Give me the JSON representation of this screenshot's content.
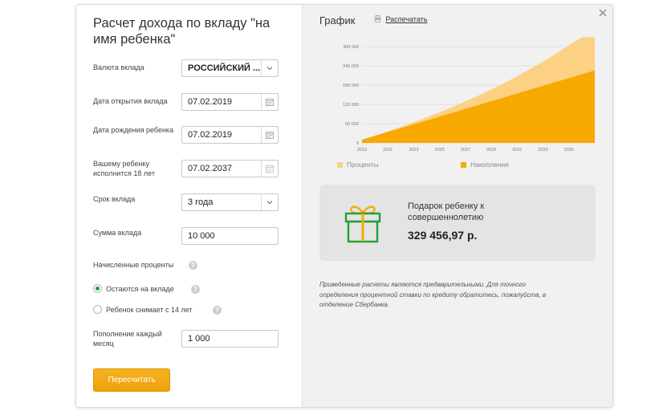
{
  "form": {
    "title": "Расчет дохода по вкладу \"на имя ребенка\"",
    "currency": {
      "label": "Валюта вклада",
      "value": "РОССИЙСКИЙ ..."
    },
    "open_date": {
      "label": "Дата открытия вклада",
      "value": "07.02.2019"
    },
    "birth_date": {
      "label": "Дата рождения ребенка",
      "value": "07.02.2019"
    },
    "age18_date": {
      "label": "Вашему ребенку исполнится 18 лет",
      "value": "07.02.2037"
    },
    "term": {
      "label": "Срок вклада",
      "value": "3 года"
    },
    "amount": {
      "label": "Сумма вклада",
      "value": "10 000"
    },
    "interest_label": "Начисленные проценты",
    "options": [
      {
        "label": "Остаются на вкладе",
        "selected": true
      },
      {
        "label": "Ребенок снимает с 14 лет",
        "selected": false
      }
    ],
    "topup": {
      "label": "Пополнение каждый месяц",
      "value": "1 000"
    },
    "recalc_button": "Пересчитать"
  },
  "graph": {
    "title": "График",
    "print_label": "Распечатать",
    "colors": {
      "interest": "#fcd183",
      "savings": "#f8a901",
      "gift_green": "#21a038",
      "gift_ribbon": "#f8a901",
      "accent": "#eda00b"
    }
  },
  "chart_data": {
    "type": "area",
    "x": [
      2019,
      2020,
      2021,
      2022,
      2023,
      2024,
      2025,
      2026,
      2027,
      2028,
      2029,
      2030,
      2031,
      2032,
      2033,
      2034,
      2035,
      2036,
      2037
    ],
    "x_ticks": [
      "2019",
      "2021",
      "2023",
      "2025",
      "2027",
      "2029",
      "2031",
      "2033",
      "2035"
    ],
    "y_ticks": [
      "0",
      "60 000",
      "120 000",
      "180 000",
      "240 000",
      "300 000"
    ],
    "ylim": [
      0,
      300000
    ],
    "series": [
      {
        "name": "Накопления",
        "values": [
          10000,
          22000,
          34000,
          46000,
          58000,
          70000,
          82000,
          94000,
          106000,
          118000,
          130000,
          142000,
          154000,
          166000,
          178000,
          190000,
          202000,
          214000,
          226000
        ]
      },
      {
        "name": "Проценты",
        "values": [
          0,
          800,
          2100,
          3900,
          6300,
          9400,
          13200,
          17700,
          23000,
          29200,
          36300,
          44400,
          53500,
          63700,
          75100,
          87700,
          101700,
          115200,
          103457
        ]
      }
    ],
    "legend": [
      "Проценты",
      "Накопления"
    ],
    "grid": true,
    "legend_position": "bottom"
  },
  "gift": {
    "text": "Подарок ребенку к совершеннолетию",
    "amount": "329 456,97 р."
  },
  "note": "Приведенные расчеты являются предварительными. Для точного определения процентной ставки по кредиту обратитесь, пожалуйста, в отделение Сбербанка."
}
